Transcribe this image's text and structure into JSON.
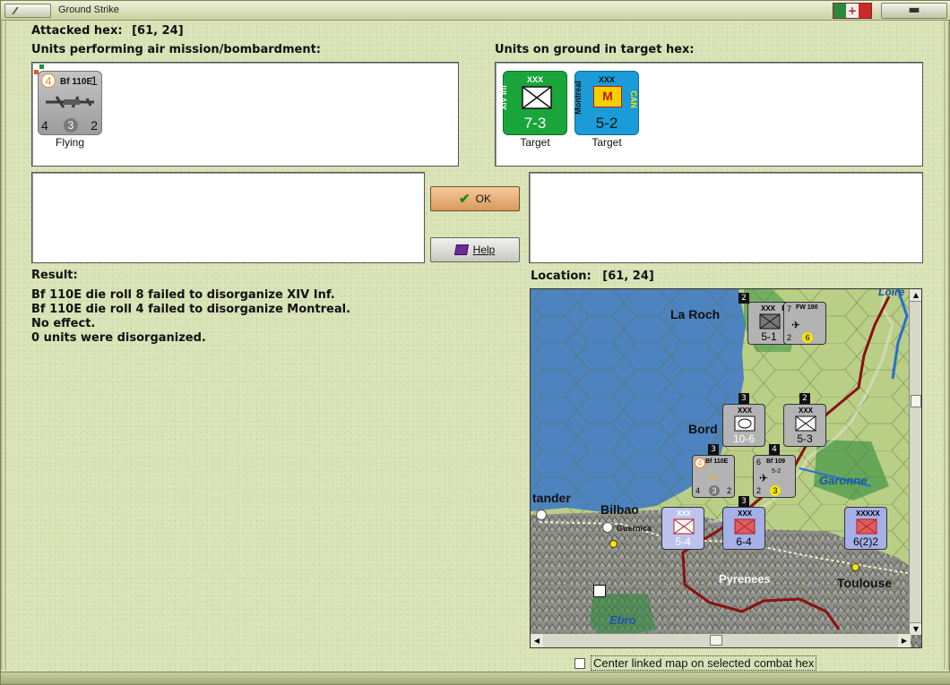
{
  "window": {
    "title": "Ground Strike"
  },
  "attacked_hex": {
    "label": "Attacked hex:",
    "value": "[61, 24]"
  },
  "air_units": {
    "label": "Units performing air mission/bombardment:",
    "items": [
      {
        "name": "Bf 110E",
        "top_left": "4",
        "top_right": "1",
        "bottom_left": "4",
        "bottom_mid": "3",
        "bottom_right": "2",
        "status": "Flying"
      }
    ]
  },
  "ground_units": {
    "label": "Units on ground in target hex:",
    "items": [
      {
        "name": "XIV Inf",
        "size": "XXX",
        "value": "7-3",
        "status": "Target",
        "color": "#1aa53a"
      },
      {
        "name": "Montreal",
        "size": "XXX",
        "value": "5-2",
        "status": "Target",
        "side": "CAN",
        "badge": "M",
        "color": "#1b9bd7"
      }
    ]
  },
  "buttons": {
    "ok": "OK",
    "help": "Help"
  },
  "result": {
    "label": "Result:",
    "lines": [
      "Bf 110E die roll 8 failed to disorganize XIV Inf.",
      "Bf 110E die roll 4 failed to disorganize Montreal.",
      "No effect.",
      "0 units were disorganized."
    ]
  },
  "location": {
    "label": "Location:",
    "value": "[61, 24]"
  },
  "map": {
    "places": [
      "La Roch",
      "Bord",
      "tander",
      "Bilbao",
      "Guernica",
      "Pyrenees",
      "Toulouse"
    ],
    "rivers": [
      "Loire",
      "Garonne",
      "Ebro"
    ],
    "counters": [
      {
        "id": "c1",
        "top": "XXX",
        "value": "5-1",
        "stack": "2",
        "corner": "R"
      },
      {
        "id": "c2",
        "top": "FW 190",
        "a": "7",
        "b": "2",
        "c": "6",
        "stack": ""
      },
      {
        "id": "c3",
        "top": "XXX",
        "value": "10-6",
        "stack": "3"
      },
      {
        "id": "c4",
        "top": "XXX",
        "value": "5-3",
        "stack": "2"
      },
      {
        "id": "c5",
        "top": "Bf 110E",
        "a": "4",
        "b": "4",
        "c": "3",
        "d": "2",
        "stack": "3"
      },
      {
        "id": "c6",
        "top": "Bf 109",
        "a": "6",
        "b": "2",
        "c": "3",
        "e": "5-2",
        "stack": "4"
      },
      {
        "id": "c7",
        "top": "XXX",
        "value": "5-4",
        "stack": ""
      },
      {
        "id": "c8",
        "top": "XXX",
        "value": "6-4",
        "stack": "3"
      },
      {
        "id": "c9",
        "top": "XXXXX",
        "value": "6(2)2",
        "stack": ""
      }
    ]
  },
  "center_checkbox": {
    "label": "Center linked map on selected combat hex",
    "checked": false
  }
}
